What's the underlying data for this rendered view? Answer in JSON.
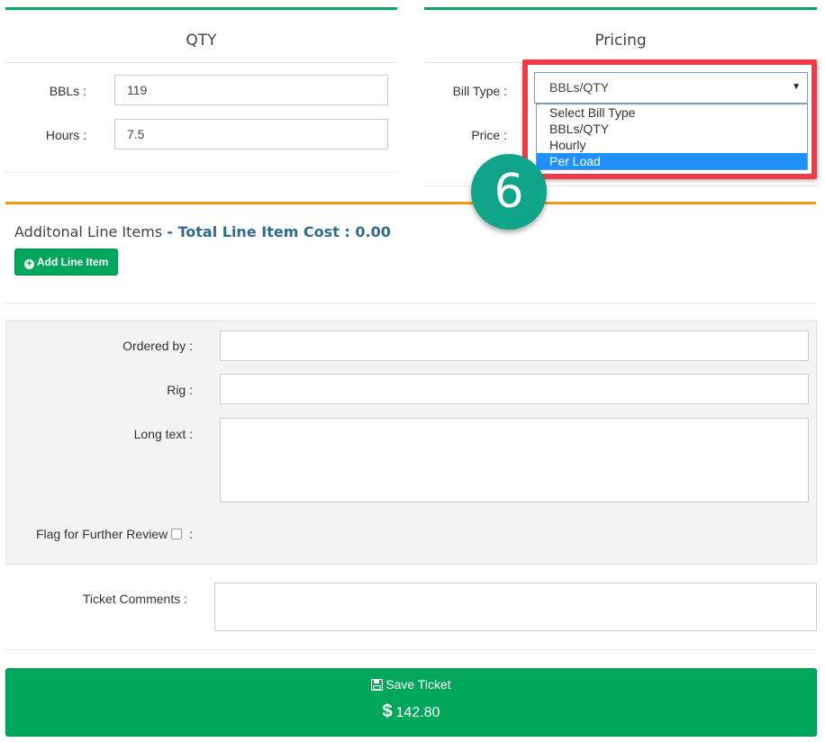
{
  "qty_panel": {
    "title": "QTY",
    "bbls_label": "BBLs :",
    "bbls_value": "119",
    "hours_label": "Hours :",
    "hours_value": "7.5"
  },
  "pricing_panel": {
    "title": "Pricing",
    "bill_type_label": "Bill Type :",
    "bill_type_value": "BBLs/QTY",
    "price_label": "Price :",
    "options": [
      "Select Bill Type",
      "BBLs/QTY",
      "Hourly",
      "Per Load"
    ],
    "highlighted_option": "Per Load"
  },
  "step_badge": "6",
  "line_items": {
    "title": "Additonal Line Items",
    "total_text": "- Total Line Item Cost : 0.00",
    "add_button": "Add Line Item"
  },
  "details": {
    "ordered_by_label": "Ordered by :",
    "rig_label": "Rig :",
    "long_text_label": "Long text :",
    "flag_label": "Flag for Further Review",
    "flag_colon": ":"
  },
  "ticket_comments_label": "Ticket Comments :",
  "save": {
    "label": "Save Ticket",
    "currency": "$",
    "amount": "142.80"
  },
  "colors": {
    "accent_green": "#00a65a",
    "highlight_red": "#ef3b45",
    "badge_teal": "#10a58a",
    "orange": "#f39c12",
    "title_blue": "#2e6b8f"
  }
}
